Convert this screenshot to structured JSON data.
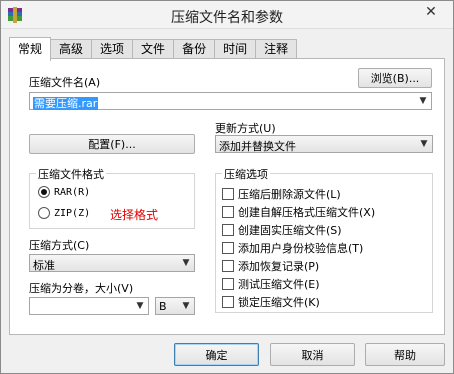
{
  "window": {
    "title": "压缩文件名和参数",
    "close_glyph": "✕"
  },
  "tabs": [
    "常规",
    "高级",
    "选项",
    "文件",
    "备份",
    "时间",
    "注释"
  ],
  "general": {
    "archive_name_label": "压缩文件名(A)",
    "browse_label": "浏览(B)...",
    "archive_name_value": "需要压缩.rar",
    "profiles_label": "配置(F)...",
    "update_mode_label": "更新方式(U)",
    "update_mode_value": "添加并替换文件",
    "format_group_title": "压缩文件格式",
    "format_options": [
      "RAR(R)",
      "ZIP(Z)"
    ],
    "selected_format": "RAR(R)",
    "format_hint": "选择格式",
    "method_label": "压缩方式(C)",
    "method_value": "标准",
    "split_label": "压缩为分卷，大小(V)",
    "split_value": "",
    "split_unit": "B",
    "options_group_title": "压缩选项",
    "options": [
      "压缩后删除源文件(L)",
      "创建自解压格式压缩文件(X)",
      "创建固实压缩文件(S)",
      "添加用户身份校验信息(T)",
      "添加恢复记录(P)",
      "测试压缩文件(E)",
      "锁定压缩文件(K)"
    ]
  },
  "footer": {
    "ok_label": "确定",
    "cancel_label": "取消",
    "help_label": "帮助"
  },
  "colors": {
    "accent": "#3399ff",
    "hint_red": "#e00000"
  }
}
